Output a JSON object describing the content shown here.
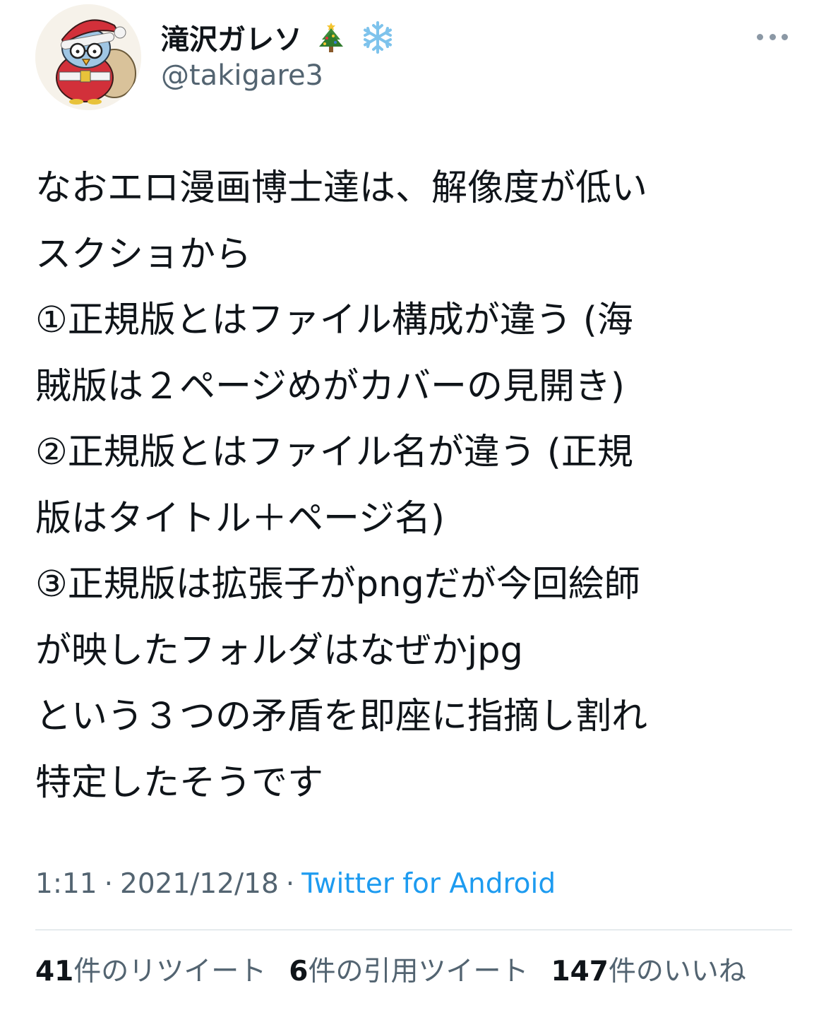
{
  "author": {
    "display_name": "滝沢ガレソ",
    "name_emojis": [
      "christmas-tree-icon",
      "snowflake-icon"
    ],
    "handle": "@takigare3"
  },
  "tweet": {
    "lines": [
      "なおエロ漫画博士達は、解像度が低い",
      "スクショから",
      "①正規版とはファイル構成が違う (海",
      "賊版は２ページめがカバーの見開き)",
      "②正規版とはファイル名が違う (正規",
      "版はタイトル＋ページ名)",
      "③正規版は拡張子がpngだが今回絵師",
      "が映したフォルダはなぜかjpg",
      "という３つの矛盾を即座に指摘し割れ",
      "特定したそうです"
    ]
  },
  "meta": {
    "time": "1:11",
    "date": "2021/12/18",
    "separator": "·",
    "source": "Twitter for Android"
  },
  "stats": {
    "retweets_count": "41",
    "retweets_label": "件のリツイート",
    "quotes_count": "6",
    "quotes_label": "件の引用ツイート",
    "likes_count": "147",
    "likes_label": "件のいいね"
  },
  "colors": {
    "text": "#0f1419",
    "secondary": "#536471",
    "link": "#1d9bf0",
    "divider": "#cfd9de"
  }
}
